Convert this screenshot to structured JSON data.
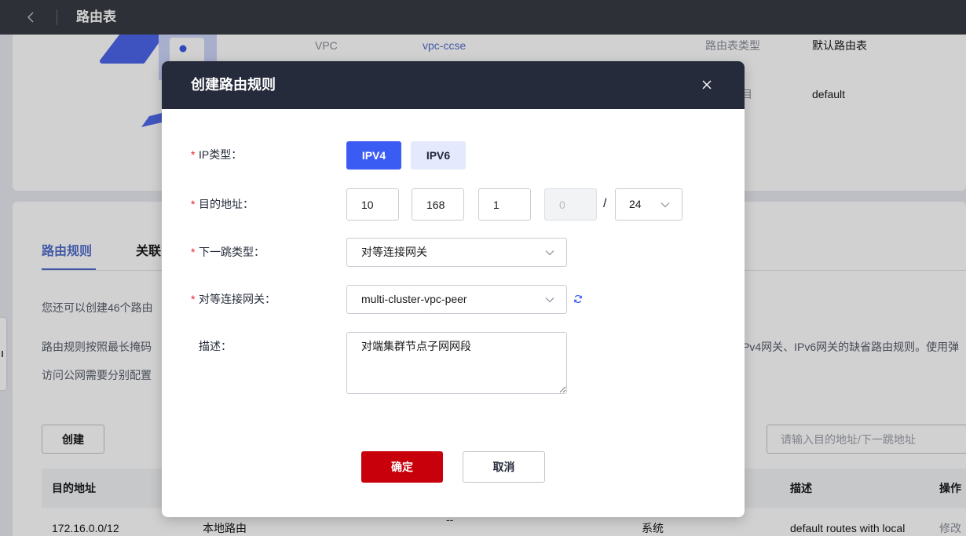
{
  "topbar": {
    "title": "路由表",
    "back_icon": "chevron-left-icon"
  },
  "summary": {
    "illustration_icon": "vpc-illustration",
    "vpc_label": "VPC",
    "vpc_value": "vpc-ccse",
    "route_table_type_label": "路由表类型",
    "route_table_type_value": "默认路由表",
    "project_label": "目",
    "project_value": "default"
  },
  "tabs": [
    {
      "label": "路由规则",
      "active": true
    },
    {
      "label": "关联",
      "active": false
    }
  ],
  "notices": {
    "quota": "您还可以创建46个路由",
    "rule_line_left": "路由规则按照最长掩码",
    "rule_line_right": "Pv4网关、IPv6网关的缺省路由规则。使用弹",
    "internet_line": "访问公网需要分别配置"
  },
  "toolbar": {
    "create_label": "创建",
    "search_placeholder": "请输入目的地址/下一跳地址"
  },
  "table": {
    "columns": [
      "目的地址",
      "描述",
      "操作"
    ],
    "rows": [
      {
        "destination": "172.16.0.0/12",
        "next_hop_type": "本地路由",
        "next_hop": "--",
        "type": "系统",
        "description": "default routes with local",
        "action": "修改"
      }
    ]
  },
  "required_mark": "*",
  "modal": {
    "title": "创建路由规则",
    "close_icon": "close-icon",
    "select_icon": "chevron-down-icon",
    "ip_type": {
      "label": "IP类型：",
      "required": true,
      "options": [
        "IPV4",
        "IPV6"
      ],
      "selected": "IPV4"
    },
    "destination": {
      "label": "目的地址：",
      "required": true,
      "octets": [
        "10",
        "168",
        "1",
        "0"
      ],
      "octet4_disabled": true,
      "separator": "/",
      "mask": "24"
    },
    "next_hop_type": {
      "label": "下一跳类型：",
      "required": true,
      "value": "对等连接网关"
    },
    "peer_gateway": {
      "label": "对等连接网关：",
      "required": true,
      "value": "multi-cluster-vpc-peer",
      "refresh_icon": "refresh-icon"
    },
    "description": {
      "label": "描述：",
      "required": false,
      "value": "对端集群节点子网网段"
    },
    "confirm_label": "确定",
    "cancel_label": "取消"
  },
  "colors": {
    "primary": "#3b5cf3",
    "confirm": "#c7000b",
    "link": "#526ecc",
    "modal_header": "#252b3a",
    "required": "#e5252f"
  }
}
